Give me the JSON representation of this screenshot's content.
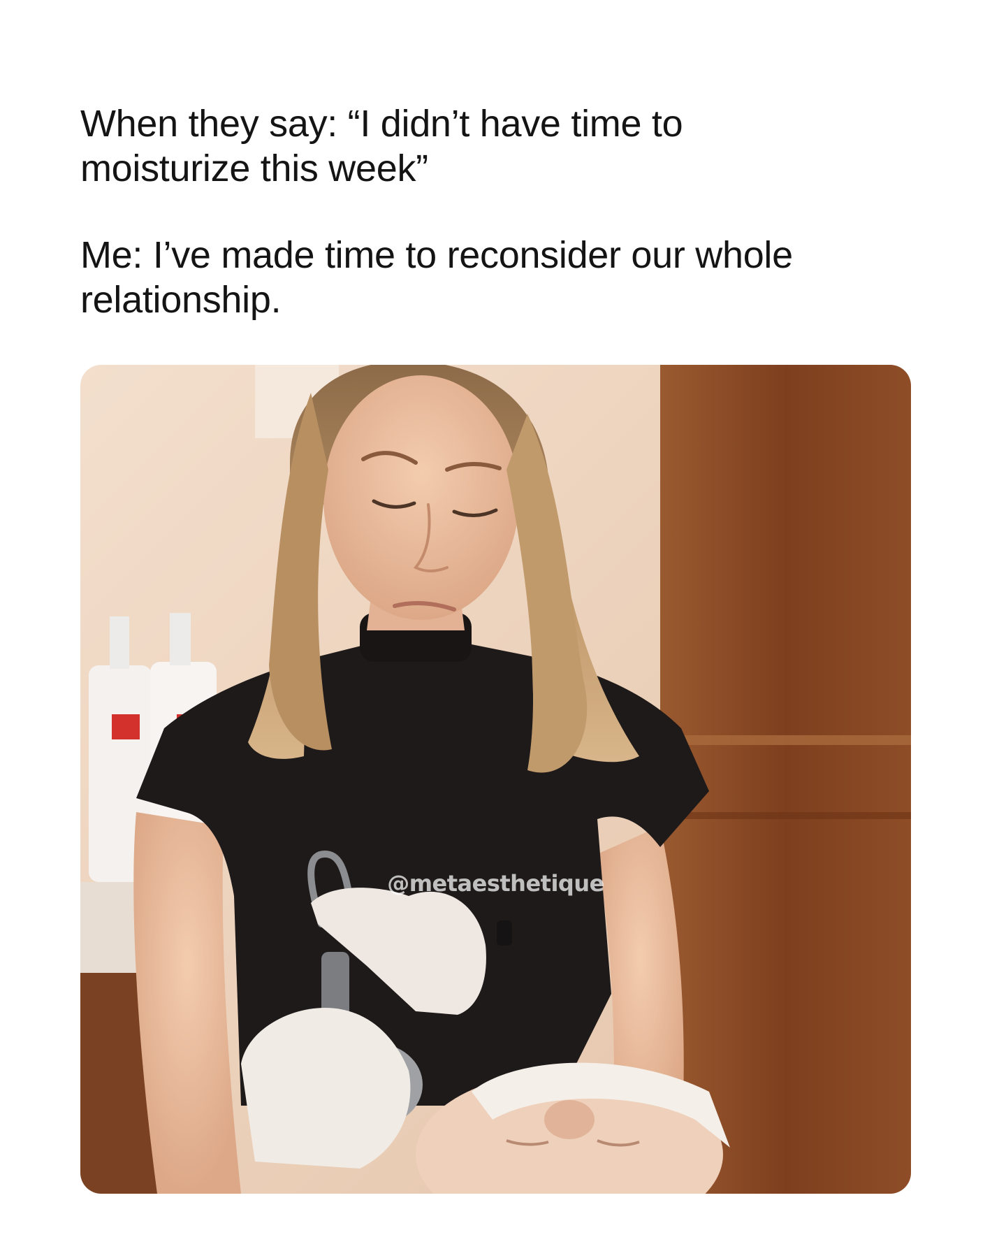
{
  "caption": {
    "line1": "When they say: “I didn’t have time to\nmoisturize this week”",
    "line2": "Me: I’ve made time to reconsider our whole\nrelationship."
  },
  "photo": {
    "watermark": "@metaesthetique",
    "icons": {
      "subject": "aesthetician-portrait",
      "tool": "skincare-device-icon",
      "bottles": "lotion-bottle-icon"
    },
    "colors": {
      "wall": "#f1dac6",
      "wood": "#8a4a24",
      "shirt": "#1e1a1a",
      "hair": "#b08a5e",
      "skin": "#e9bfa1",
      "glove": "#efe8e4"
    }
  }
}
